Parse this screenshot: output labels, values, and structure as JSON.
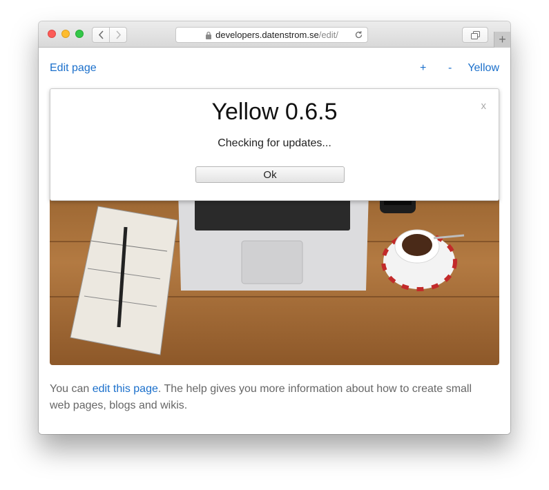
{
  "browser": {
    "url_host": "developers.datenstrom.se",
    "url_path": "/edit/",
    "new_tab_label": "+"
  },
  "nav": {
    "edit_page": "Edit page",
    "plus": "+",
    "minus": "-",
    "site_name": "Yellow"
  },
  "dialog": {
    "title": "Yellow 0.6.5",
    "message": "Checking for updates...",
    "ok_button": "Ok",
    "close_label": "x"
  },
  "content": {
    "prefix": "You can ",
    "link_text": "edit this page",
    "suffix": ". The help gives you more information about how to create small web pages, blogs and wikis."
  },
  "colors": {
    "link": "#1a6fcb",
    "text": "#666666"
  }
}
